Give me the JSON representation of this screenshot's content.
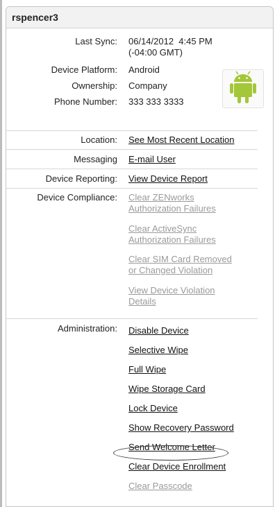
{
  "panel": {
    "title": "rspencer3"
  },
  "device_info": {
    "last_sync_label": "Last Sync:",
    "last_sync_line1": "06/14/2012  4:45 PM",
    "last_sync_line2": "(-04:00 GMT)",
    "platform_label": "Device Platform:",
    "platform_value": "Android",
    "ownership_label": "Ownership:",
    "ownership_value": "Company",
    "phone_label": "Phone Number:",
    "phone_value": "333 333 3333",
    "platform_icon": "android-icon"
  },
  "location": {
    "label": "Location:",
    "link": "See Most Recent Location"
  },
  "messaging": {
    "label": "Messaging",
    "link": "E-mail User"
  },
  "reporting": {
    "label": "Device Reporting:",
    "link": "View Device Report"
  },
  "compliance": {
    "label": "Device Compliance:",
    "links": [
      {
        "line1": "Clear ZENworks",
        "line2": "Authorization Failures"
      },
      {
        "line1": "Clear ActiveSync",
        "line2": "Authorization Failures"
      },
      {
        "line1": "Clear SIM Card Removed",
        "line2": "or Changed Violation"
      },
      {
        "line1": "View Device Violation",
        "line2": "Details"
      }
    ]
  },
  "administration": {
    "label": "Administration:",
    "links": [
      "Disable Device",
      "Selective Wipe",
      "Full Wipe",
      "Wipe Storage Card",
      "Lock Device",
      "Show Recovery Password",
      "Send Welcome Letter",
      "Clear Device Enrollment",
      "Clear Passcode"
    ]
  },
  "colors": {
    "android_green": "#a4c639",
    "disabled_link": "#9a9a9a",
    "highlight_oval": "#333333"
  }
}
